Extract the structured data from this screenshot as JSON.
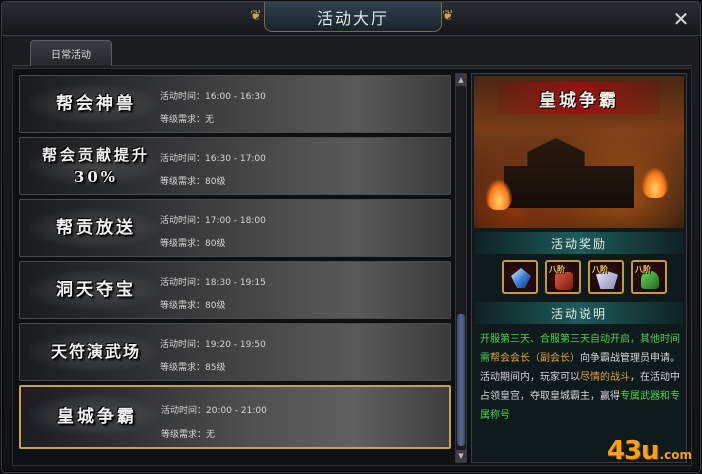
{
  "window": {
    "title": "活动大厅",
    "close_symbol": "✕"
  },
  "tabs": [
    {
      "label": "日常活动",
      "active": true
    }
  ],
  "activities": [
    {
      "name": "帮会神兽",
      "time": "活动时间：16:00 - 16:30",
      "level": "等级需求：无",
      "selected": false
    },
    {
      "name": "帮会贡献提升30%",
      "time": "活动时间：16:30 - 17:00",
      "level": "等级需求：80级",
      "selected": false
    },
    {
      "name": "帮贡放送",
      "time": "活动时间：17:00 - 18:00",
      "level": "等级需求：80级",
      "selected": false
    },
    {
      "name": "洞天夺宝",
      "time": "活动时间：18:30 - 19:15",
      "level": "等级需求：80级",
      "selected": false
    },
    {
      "name": "天符演武场",
      "time": "活动时间：19:20 - 19:50",
      "level": "等级需求：85级",
      "selected": false
    },
    {
      "name": "皇城争霸",
      "time": "活动时间：20:00 - 21:00",
      "level": "等级需求：无",
      "selected": true
    }
  ],
  "detail": {
    "banner_title": "皇城争霸",
    "rewards_heading": "活动奖励",
    "rewards": [
      {
        "icon": "gem-icon",
        "badge": ""
      },
      {
        "icon": "armor-icon",
        "badge": "八阶"
      },
      {
        "icon": "wing-icon",
        "badge": "八阶"
      },
      {
        "icon": "helmet-icon",
        "badge": "八阶"
      }
    ],
    "description_heading": "活动说明",
    "description": {
      "p1": "开服第三天、合服第三天自动开启，其他时间需",
      "p2": "帮会会长（副会长）",
      "p3": "向争霸战管理员申请。活动期间内，玩家可以",
      "p4": "尽情的战斗",
      "p5": "，在活动中占领皇宫，夺取皇城霸主，赢得",
      "p6": "专属武器和专属称号"
    }
  },
  "scrollbar": {
    "up": "▲",
    "down": "▼"
  },
  "watermark": {
    "number": "43u",
    "domain": ".com"
  },
  "colors": {
    "accent_gold": "#c7a34f",
    "section_teal": "#1d5c5a",
    "highlight_green": "#4fd34f",
    "highlight_orange": "#e0a33a"
  }
}
